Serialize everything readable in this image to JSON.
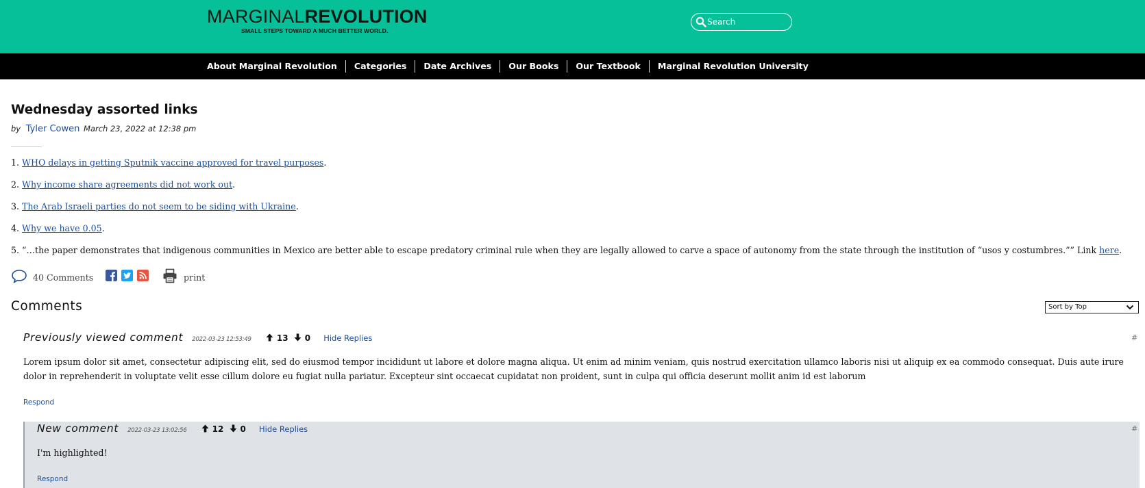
{
  "site": {
    "logo_light": "MARGINAL",
    "logo_bold": "REVOLUTION",
    "tagline": "SMALL STEPS TOWARD A MUCH BETTER WORLD.",
    "search_placeholder": "Search",
    "brand_color": "#06c09a"
  },
  "nav": {
    "items": [
      "About Marginal Revolution",
      "Categories",
      "Date Archives",
      "Our Books",
      "Our Textbook",
      "Marginal Revolution University"
    ]
  },
  "post": {
    "title": "Wednesday assorted links",
    "by": "by",
    "author": "Tyler Cowen",
    "date": "March 23, 2022 at 12:38 pm",
    "links": [
      {
        "num": "1. ",
        "link": "WHO delays in getting Sputnik vaccine approved for travel purposes",
        "suffix": "."
      },
      {
        "num": "2. ",
        "link": "Why income share agreements did not work out",
        "suffix": "."
      },
      {
        "num": "3. ",
        "link": "The Arab Israeli parties do not seem to be siding with Ukraine",
        "suffix": "."
      },
      {
        "num": "4. ",
        "link": "Why we have 0.05",
        "suffix": "."
      }
    ],
    "item5": {
      "text": "5. “…the paper demonstrates that indigenous communities in Mexico are better able to escape predatory criminal rule when they are legally allowed to carve a space of autonomy from the state through the institution of “usos y costumbres.”” Link ",
      "link": "here",
      "suffix": "."
    },
    "comment_count": "40 Comments",
    "print": "print"
  },
  "comments": {
    "title": "Comments",
    "sort_value": "Sort by Top",
    "permalink": "#",
    "items": [
      {
        "author": "Previously viewed comment",
        "date": "2022-03-23 12:53:49",
        "up": "13",
        "down": "0",
        "hide": "Hide Replies",
        "body": "Lorem ipsum dolor sit amet, consectetur adipiscing elit, sed do eiusmod tempor incididunt ut labore et dolore magna aliqua. Ut enim ad minim veniam, quis nostrud exercitation ullamco laboris nisi ut aliquip ex ea commodo consequat. Duis aute irure dolor in reprehenderit in voluptate velit esse cillum dolore eu fugiat nulla pariatur. Excepteur sint occaecat cupidatat non proident, sunt in culpa qui officia deserunt mollit anim id est laborum",
        "respond": "Respond"
      },
      {
        "author": "New comment",
        "date": "2022-03-23 13:02:56",
        "up": "12",
        "down": "0",
        "hide": "Hide Replies",
        "body": "I'm highlighted!",
        "respond": "Respond"
      }
    ]
  }
}
